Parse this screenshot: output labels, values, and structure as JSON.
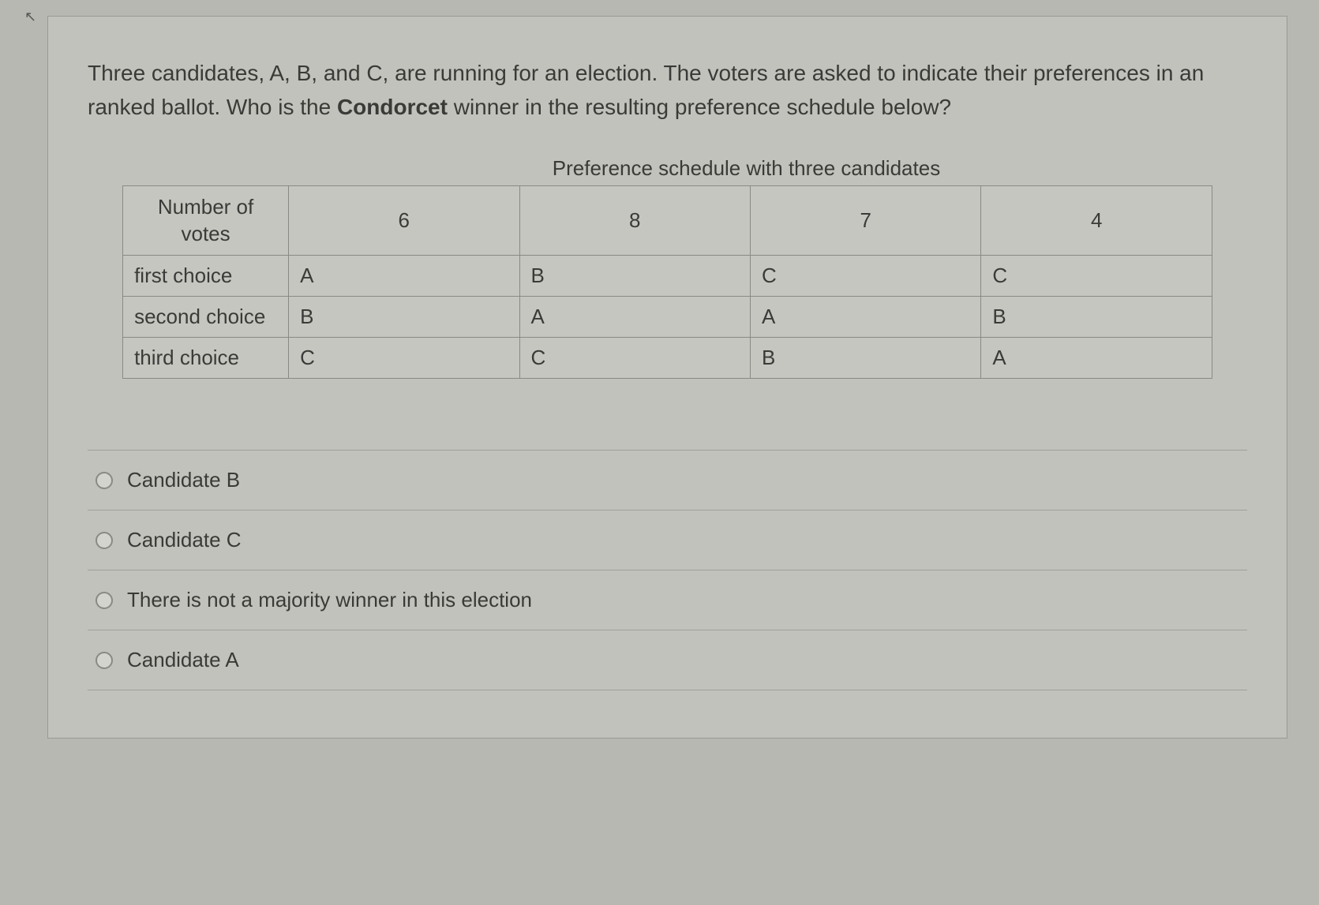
{
  "question": {
    "text_parts": [
      "Three candidates, A, B, and C, are running for an election. The voters are asked to indicate their preferences in an ranked ballot. Who is the ",
      "Condorcet",
      " winner in the resulting preference schedule below?"
    ]
  },
  "table": {
    "caption": "Preference schedule with three candidates",
    "header_label": "Number of votes",
    "columns": [
      "6",
      "8",
      "7",
      "4"
    ],
    "rows": [
      {
        "label": "first choice",
        "cells": [
          "A",
          "B",
          "C",
          "C"
        ]
      },
      {
        "label": "second choice",
        "cells": [
          "B",
          "A",
          "A",
          "B"
        ]
      },
      {
        "label": "third choice",
        "cells": [
          "C",
          "C",
          "B",
          "A"
        ]
      }
    ]
  },
  "options": [
    {
      "label": "Candidate B"
    },
    {
      "label": "Candidate C"
    },
    {
      "label": "There is not a majority winner in this election"
    },
    {
      "label": "Candidate A"
    }
  ]
}
